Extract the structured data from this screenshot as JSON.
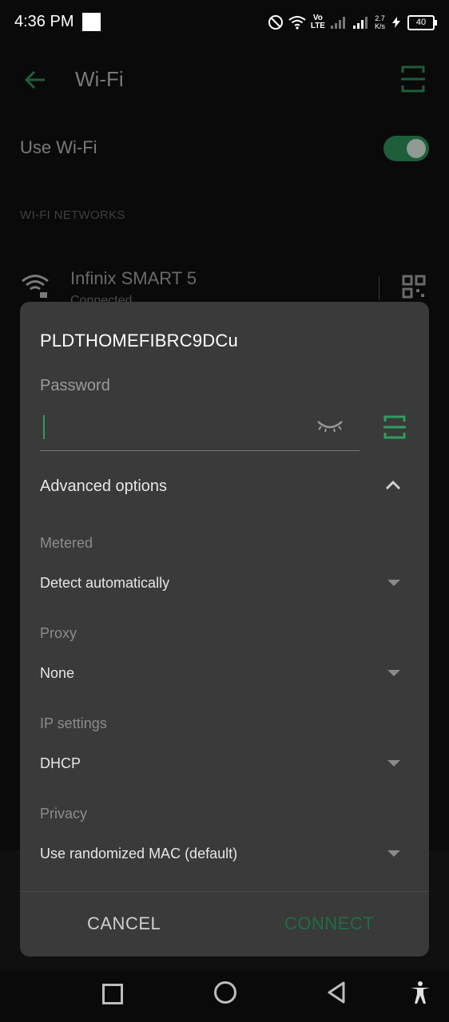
{
  "status_bar": {
    "time": "4:36 PM",
    "network_speed_value": "2.7",
    "network_speed_unit": "K/s",
    "volte_top": "Vo",
    "volte_bottom": "LTE",
    "battery": "40"
  },
  "app_bar": {
    "title": "Wi-Fi"
  },
  "wifi_toggle": {
    "label": "Use Wi-Fi",
    "enabled": true
  },
  "networks_section": {
    "header": "WI-FI NETWORKS",
    "items": [
      {
        "name": "Infinix SMART 5",
        "status": "Connected"
      }
    ]
  },
  "dialog": {
    "ssid": "PLDTHOMEFIBRC9DCu",
    "password_label": "Password",
    "password_value": "",
    "advanced_label": "Advanced options",
    "fields": [
      {
        "label": "Metered",
        "value": "Detect automatically"
      },
      {
        "label": "Proxy",
        "value": "None"
      },
      {
        "label": "IP settings",
        "value": "DHCP"
      },
      {
        "label": "Privacy",
        "value": "Use randomized MAC (default)"
      }
    ],
    "cancel_label": "CANCEL",
    "connect_label": "CONNECT"
  },
  "colors": {
    "accent": "#2f9e5c",
    "dialog_bg": "#3a3a3a",
    "background": "#0a0a0a"
  }
}
